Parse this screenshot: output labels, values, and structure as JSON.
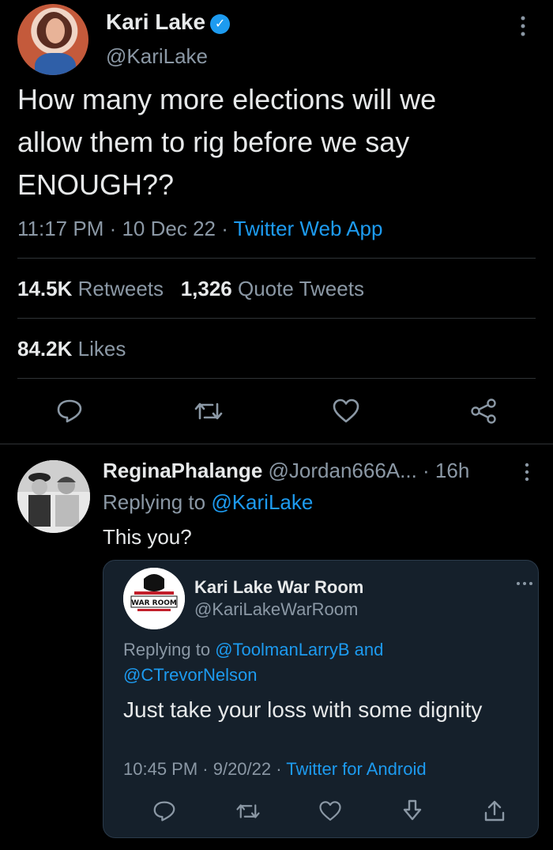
{
  "main_tweet": {
    "name": "Kari Lake",
    "handle": "@KariLake",
    "verified_icon": "verified-badge-icon",
    "text_line1": "How many more elections will we",
    "text_line2": "allow them to rig before we say",
    "text_line3": "ENOUGH??",
    "time_date": "11:17 PM · 10 Dec 22 ·",
    "source": "Twitter Web App",
    "retweets_count": "14.5K",
    "retweets_label": "Retweets",
    "quotes_count": "1,326",
    "quotes_label": "Quote Tweets",
    "likes_count": "84.2K",
    "likes_label": "Likes",
    "more_icon": "vertical-dots-icon"
  },
  "reply_tweet": {
    "name": "ReginaPhalange",
    "handle": "@Jordan666A...",
    "time": "· 16h",
    "replying_prefix": "Replying to",
    "replying_to": "@KariLake",
    "text": "This you?"
  },
  "quoted_tweet": {
    "name": "Kari Lake War Room",
    "handle": "@KariLakeWarRoom",
    "avatar_text": "WAR ROOM",
    "replying_prefix": "Replying to",
    "replying_to_1": "@ToolmanLarryB",
    "replying_and": "and",
    "replying_to_2": "@CTrevorNelson",
    "text": "Just take your loss with some dignity",
    "time_date": "10:45 PM · 9/20/22 ·",
    "source": "Twitter for Android",
    "more_icon": "horizontal-dots-icon"
  },
  "colors": {
    "background": "#000000",
    "text": "#e7e9ea",
    "muted": "#8b98a5",
    "accent": "#1d9bf0",
    "quote_bg": "#15202b"
  }
}
